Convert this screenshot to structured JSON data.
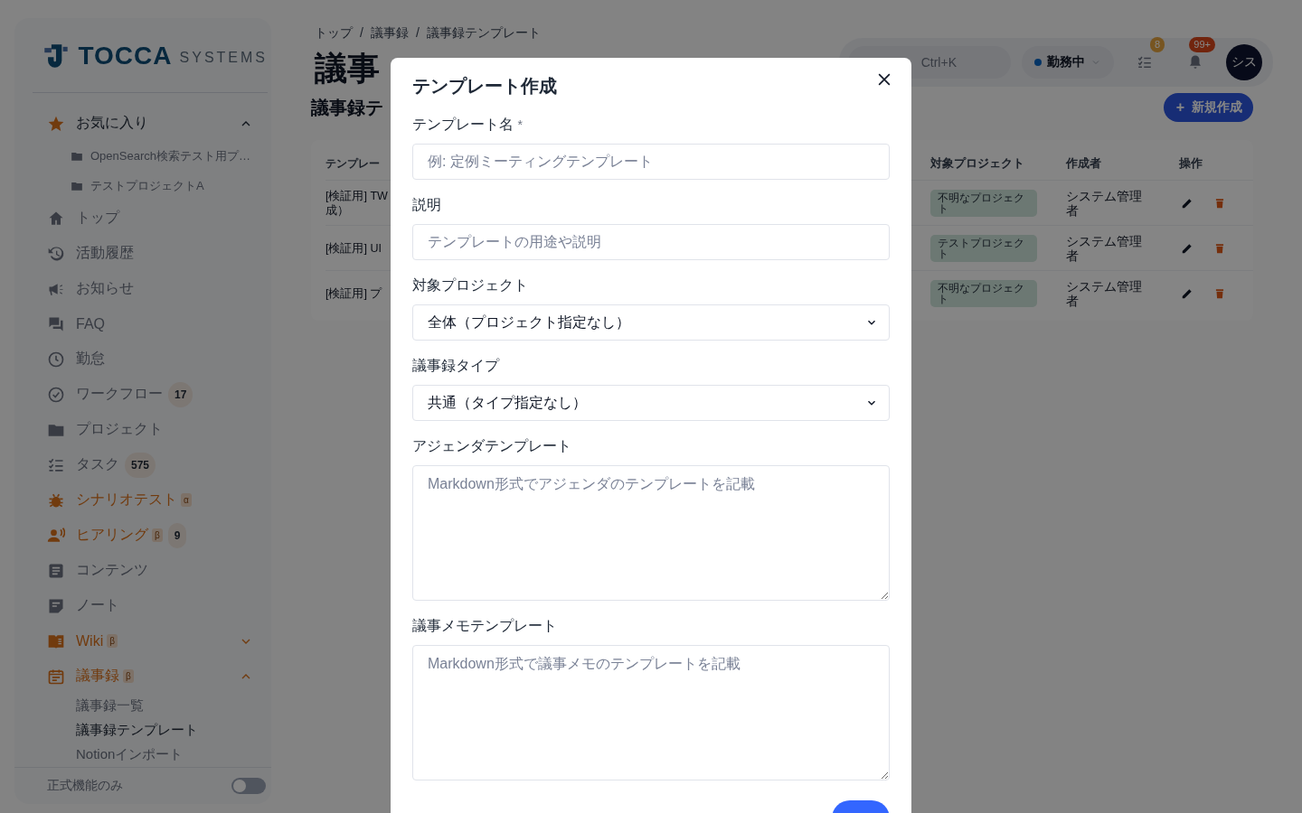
{
  "sidebar": {
    "logo": {
      "name": "TOCCA",
      "suffix": "SYSTEMS"
    },
    "items": [
      {
        "kind": "group",
        "label": "お気に入り",
        "expanded": true,
        "accent": false,
        "children": [
          {
            "label": "OpenSearch検索テスト用プ…"
          },
          {
            "label": "テストプロジェクトA"
          }
        ]
      },
      {
        "kind": "link",
        "label": "トップ",
        "accent": false
      },
      {
        "kind": "link",
        "label": "活動履歴",
        "accent": false
      },
      {
        "kind": "link",
        "label": "お知らせ",
        "accent": false
      },
      {
        "kind": "link",
        "label": "FAQ",
        "accent": false
      },
      {
        "kind": "link",
        "label": "勤怠",
        "accent": false
      },
      {
        "kind": "link",
        "label": "ワークフロー",
        "accent": false,
        "badge": "17"
      },
      {
        "kind": "link",
        "label": "プロジェクト",
        "accent": false
      },
      {
        "kind": "link",
        "label": "タスク",
        "accent": false,
        "badge": "575"
      },
      {
        "kind": "link",
        "label": "シナリオテスト",
        "accent": true,
        "tag": "α"
      },
      {
        "kind": "link",
        "label": "ヒアリング",
        "accent": true,
        "tag": "β",
        "badge": "9"
      },
      {
        "kind": "link",
        "label": "コンテンツ",
        "accent": false
      },
      {
        "kind": "link",
        "label": "ノート",
        "accent": false
      },
      {
        "kind": "group",
        "label": "Wiki",
        "accent": true,
        "tag": "β",
        "expanded": false
      },
      {
        "kind": "group",
        "label": "議事録",
        "accent": true,
        "tag": "β",
        "expanded": true,
        "children": [
          {
            "label": "議事録一覧",
            "selected": false
          },
          {
            "label": "議事録テンプレート",
            "selected": true
          },
          {
            "label": "Notionインポート",
            "selected": false
          }
        ]
      }
    ],
    "footer": {
      "label": "正式機能のみ",
      "on": false
    }
  },
  "header": {
    "breadcrumb": [
      "トップ",
      "議事録",
      "議事録テンプレート"
    ],
    "separator": "/",
    "title": "議事",
    "search": {
      "shortcut": "Ctrl+K"
    },
    "status": {
      "label": "勤務中"
    },
    "tasks_badge": "8",
    "notifications_badge": "99+",
    "avatar": "シス"
  },
  "main": {
    "subtitle": "議事録テ",
    "new_button": "新規作成",
    "new_button_icon": "+",
    "table": {
      "columns": [
        "テンプレー",
        "対象プロジェクト",
        "作成者",
        "操作"
      ],
      "rows": [
        {
          "name": [
            "[検証用] TW",
            "成）"
          ],
          "project": "不明なプロジェクト",
          "author": "システム管理者"
        },
        {
          "name": [
            "[検証用] UI"
          ],
          "project": "テストプロジェクト",
          "author": "システム管理者"
        },
        {
          "name": [
            "[検証用] プ"
          ],
          "project": "不明なプロジェクト",
          "author": "システム管理者"
        }
      ]
    }
  },
  "modal": {
    "title": "テンプレート作成",
    "fields": [
      {
        "kind": "text",
        "label": "テンプレート名",
        "required_mark": "*",
        "placeholder": "例: 定例ミーティングテンプレート"
      },
      {
        "kind": "text",
        "label": "説明",
        "placeholder": "テンプレートの用途や説明"
      },
      {
        "kind": "select",
        "label": "対象プロジェクト",
        "value": "全体（プロジェクト指定なし）"
      },
      {
        "kind": "select",
        "label": "議事録タイプ",
        "value": "共通（タイプ指定なし）"
      },
      {
        "kind": "textarea",
        "label": "アジェンダテンプレート",
        "placeholder": "Markdown形式でアジェンダのテンプレートを記載"
      },
      {
        "kind": "textarea",
        "label": "議事メモテンプレート",
        "placeholder": "Markdown形式で議事メモのテンプレートを記載"
      }
    ]
  }
}
